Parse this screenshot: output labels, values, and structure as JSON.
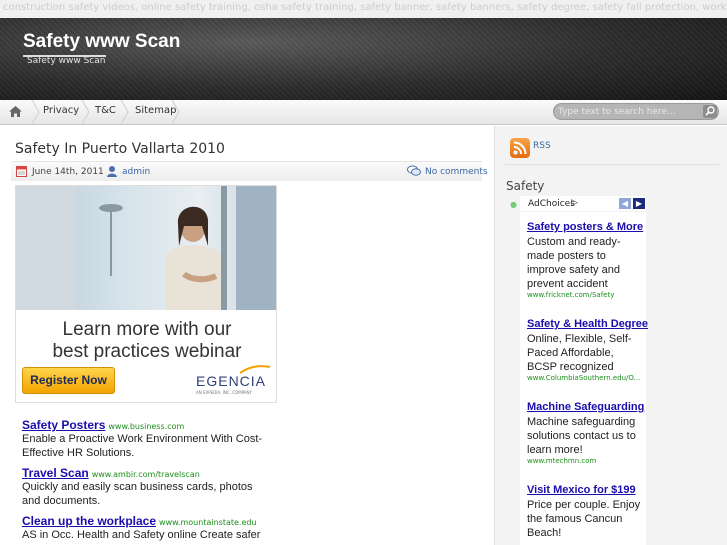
{
  "keyword_bar": "construction safety videos, online safety training, osha safety training, safety banner, safety banners, safety degree, safety fall protection, workplace safety posters",
  "header": {
    "site_title": "Safety www Scan",
    "tagline": "Safety www Scan"
  },
  "nav": {
    "items": [
      {
        "label": "Privacy"
      },
      {
        "label": "T&C"
      },
      {
        "label": "Sitemap"
      }
    ],
    "search_placeholder": "Type text to search here..."
  },
  "post": {
    "title": "Safety In Puerto Vallarta 2010",
    "date": "June 14th, 2011",
    "author": "admin",
    "comments": "No comments"
  },
  "banner_ad": {
    "headline_line1": "Learn more with our",
    "headline_line2": "best practices webinar",
    "cta": "Register Now",
    "brand": "EGENCIA",
    "brand_sub": "AN EXPEDIA, INC. COMPANY"
  },
  "text_ads": [
    {
      "title": "Safety Posters",
      "url": "www.business.com",
      "desc": "Enable a Proactive Work Environment With Cost-Effective HR Solutions."
    },
    {
      "title": "Travel Scan",
      "url": "www.ambir.com/travelscan",
      "desc": "Quickly and easily scan business cards, photos and documents."
    },
    {
      "title": "Clean up the workplace",
      "url": "www.mountainstate.edu",
      "desc": "AS in Occ. Health and Safety online Create safer"
    }
  ],
  "sidebar": {
    "rss_label": "RSS",
    "heading": "Safety",
    "adchoices": "AdChoices",
    "ads": [
      {
        "title": "Safety posters & More",
        "desc": "Custom and ready-made posters to improve safety and prevent accident",
        "url": "www.fricknet.com/Safety"
      },
      {
        "title": "Safety & Health Degree",
        "desc": "Online, Flexible, Self-Paced Affordable, BCSP recognized",
        "url": "www.ColumbiaSouthern.edu/O..."
      },
      {
        "title": "Machine Safeguarding",
        "desc": "Machine safeguarding solutions contact us to learn more!",
        "url": "www.mtechmn.com"
      },
      {
        "title": "Visit Mexico for $199",
        "desc": "Price per couple. Enjoy the famous Cancun Beach!",
        "url": ""
      }
    ]
  }
}
